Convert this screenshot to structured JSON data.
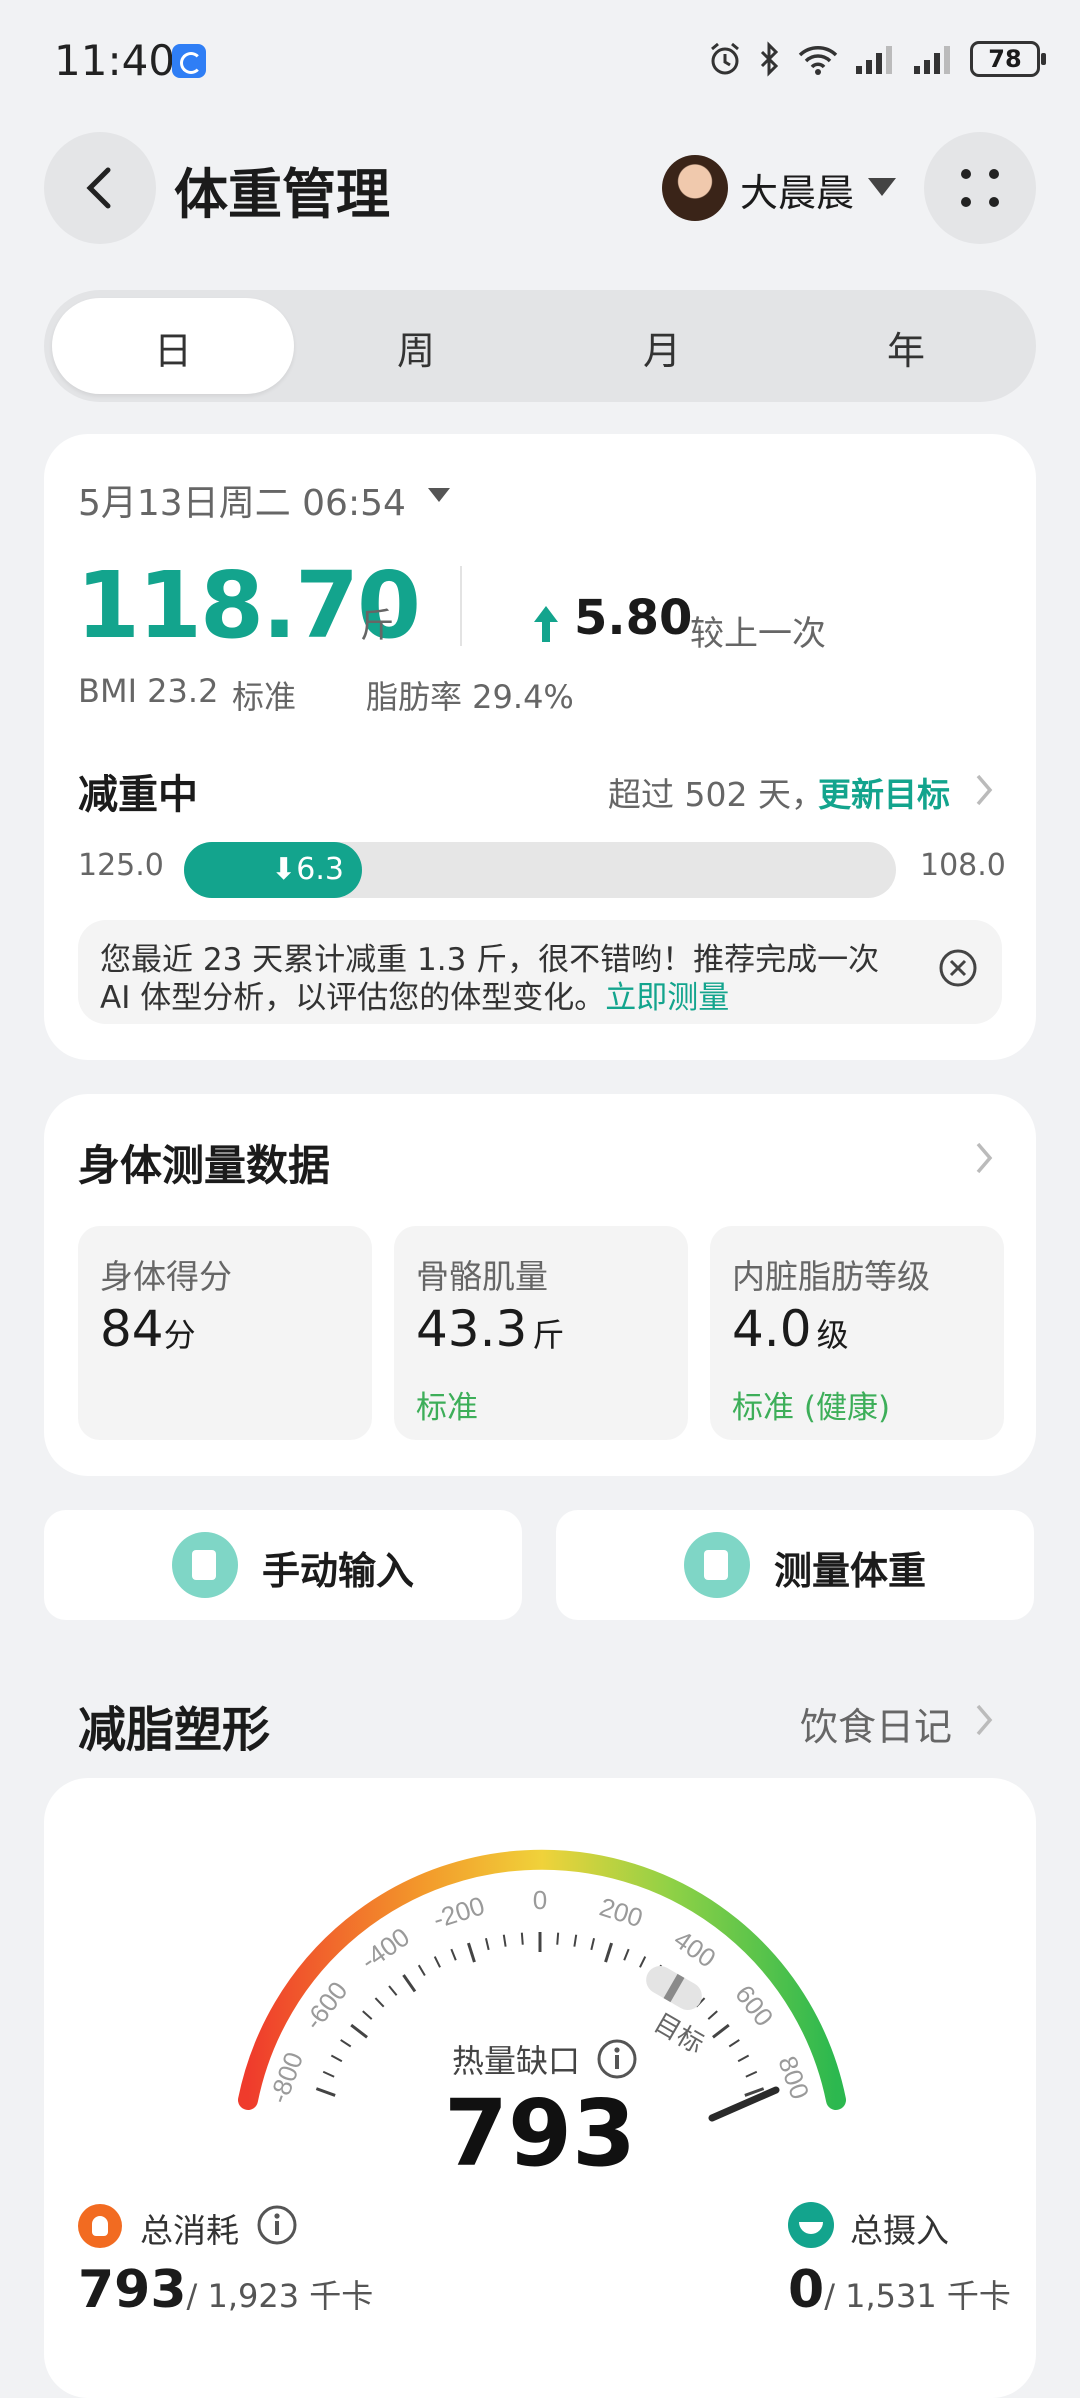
{
  "status_bar": {
    "time": "11:40",
    "battery": "78"
  },
  "header": {
    "title": "体重管理",
    "user_name": "大晨晨"
  },
  "tabs": [
    {
      "label": "日",
      "active": true
    },
    {
      "label": "周",
      "active": false
    },
    {
      "label": "月",
      "active": false
    },
    {
      "label": "年",
      "active": false
    }
  ],
  "weight_card": {
    "datetime": "5月13日周二 06:54",
    "weight": "118.70",
    "weight_unit": "斤",
    "change_value": "5.80",
    "change_label": "较上一次",
    "bmi": "BMI 23.2",
    "bmi_status": "标准",
    "body_fat": "脂肪率 29.4%",
    "goal_status": "减重中",
    "goal_days_text": "超过 502 天，",
    "update_goal": "更新目标",
    "progress_start": "125.0",
    "progress_end": "108.0",
    "progress_label": "6.3",
    "progress_fraction": 0.25,
    "tip_text_1": "您最近 23 天累计减重 1.3 斤，很不错哟！推荐完成一次",
    "tip_text_2": "AI 体型分析，以评估您的体型变化。",
    "tip_link": "立即测量"
  },
  "body_metrics": {
    "title": "身体测量数据",
    "items": [
      {
        "label": "身体得分",
        "value": "84",
        "unit": "分",
        "status": ""
      },
      {
        "label": "骨骼肌量",
        "value": "43.3",
        "unit": "斤",
        "status": "标准"
      },
      {
        "label": "内脏脂肪等级",
        "value": "4.0",
        "unit": "级",
        "status": "标准 (健康)"
      }
    ]
  },
  "actions": {
    "manual": "手动输入",
    "measure": "测量体重"
  },
  "fat_loss": {
    "title": "减脂塑形",
    "diary_link": "饮食日记",
    "gauge_ticks": [
      "-800",
      "-600",
      "-400",
      "-200",
      "0",
      "200",
      "400",
      "600",
      "800"
    ],
    "gauge_target": "目标",
    "gauge_label": "热量缺口",
    "gauge_value": "793",
    "total_burn_label": "总消耗",
    "total_burn_value": "793",
    "total_burn_target": "/ 1,923 千卡",
    "total_intake_label": "总摄入",
    "total_intake_value": "0",
    "total_intake_target": "/ 1,531 千卡"
  },
  "colors": {
    "accent": "#13a48d",
    "status_green": "#3dae59"
  }
}
